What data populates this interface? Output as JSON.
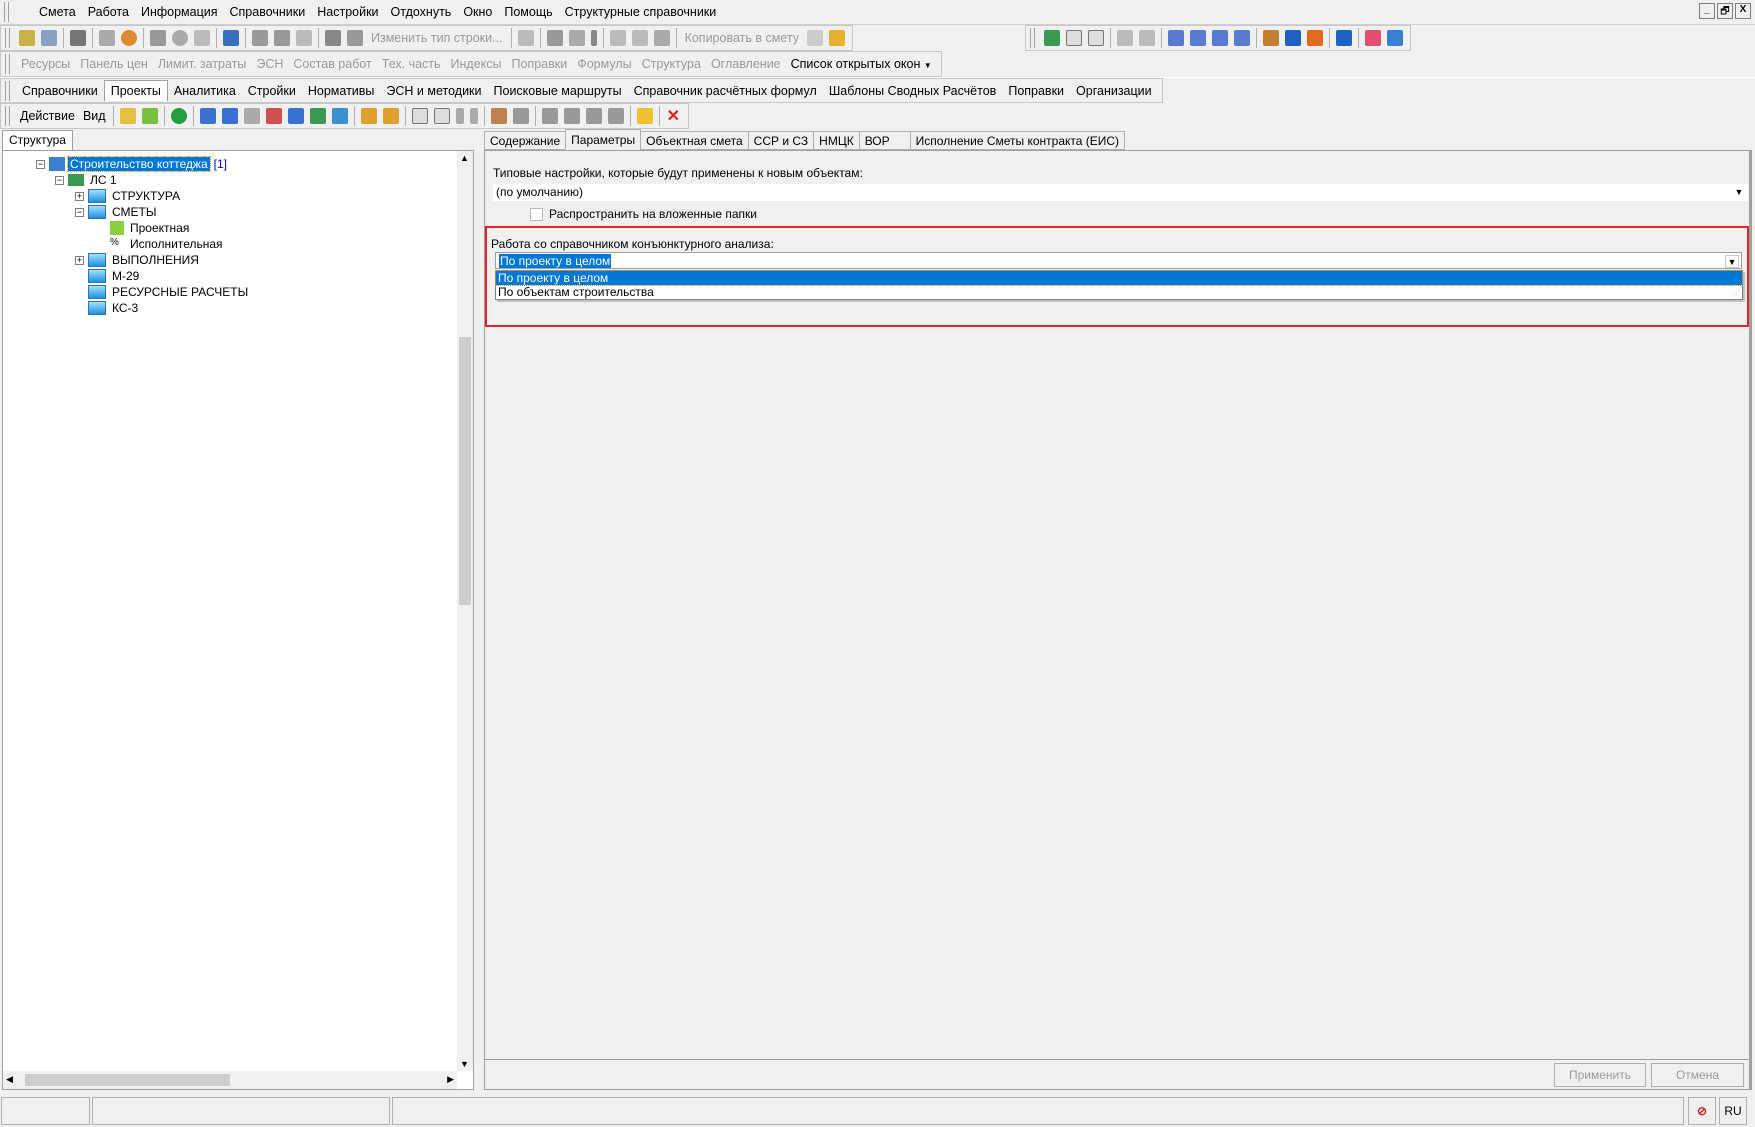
{
  "menu": [
    "Смета",
    "Работа",
    "Информация",
    "Справочники",
    "Настройки",
    "Отдохнуть",
    "Окно",
    "Помощь",
    "Структурные справочники"
  ],
  "window_controls": {
    "minimize": "_",
    "restore": "🗗",
    "close": "X"
  },
  "toolbar1": {
    "change_row_type": "Изменить тип строки...",
    "copy_to_estimate": "Копировать в смету"
  },
  "toolbar2": [
    "Ресурсы",
    "Панель цен",
    "Лимит. затраты",
    "ЭСН",
    "Состав работ",
    "Тех. часть",
    "Индексы",
    "Поправки",
    "Формулы",
    "Структура",
    "Оглавление"
  ],
  "open_windows": "Список открытых окон",
  "module_tabs": [
    "Справочники",
    "Проекты",
    "Аналитика",
    "Стройки",
    "Нормативы",
    "ЭСН и методики",
    "Поисковые маршруты",
    "Справочник расчётных формул",
    "Шаблоны Сводных Расчётов",
    "Поправки",
    "Организации"
  ],
  "active_module_tab": "Проекты",
  "action_bar": {
    "action": "Действие",
    "view": "Вид"
  },
  "left_panel": {
    "tab": "Структура",
    "tree": [
      {
        "label": "Строительство коттеджа",
        "badge": "[1]",
        "selected": true
      },
      {
        "label": "ЛС 1"
      },
      {
        "label": "СТРУКТУРА"
      },
      {
        "label": "СМЕТЫ"
      },
      {
        "label": "Проектная"
      },
      {
        "label": "Исполнительная"
      },
      {
        "label": "ВЫПОЛНЕНИЯ"
      },
      {
        "label": "М-29"
      },
      {
        "label": "РЕСУРСНЫЕ РАСЧЕТЫ"
      },
      {
        "label": "КС-3"
      }
    ]
  },
  "right_panel": {
    "tabs": [
      "Содержание",
      "Параметры",
      "Объектная смета",
      "ССР и СЗ",
      "НМЦК",
      "ВОР",
      "Исполнение Сметы контракта (ЕИС)"
    ],
    "active_tab": "Параметры",
    "defaults_label": "Типовые настройки, которые будут применены к новым объектам:",
    "defaults_value": "(по умолчанию)",
    "propagate_label": "Распространить на вложенные папки",
    "propagate_checked": false,
    "analysis_label": "Работа со справочником конъюнктурного анализа:",
    "analysis_value": "По проекту в целом",
    "analysis_options": [
      "По проекту в целом",
      "По объектам строительства"
    ],
    "apply": "Применить",
    "cancel": "Отмена"
  },
  "status": {
    "lang": "RU"
  },
  "colors": {
    "highlight": "#0078d7",
    "annotation": "#e8202a"
  }
}
